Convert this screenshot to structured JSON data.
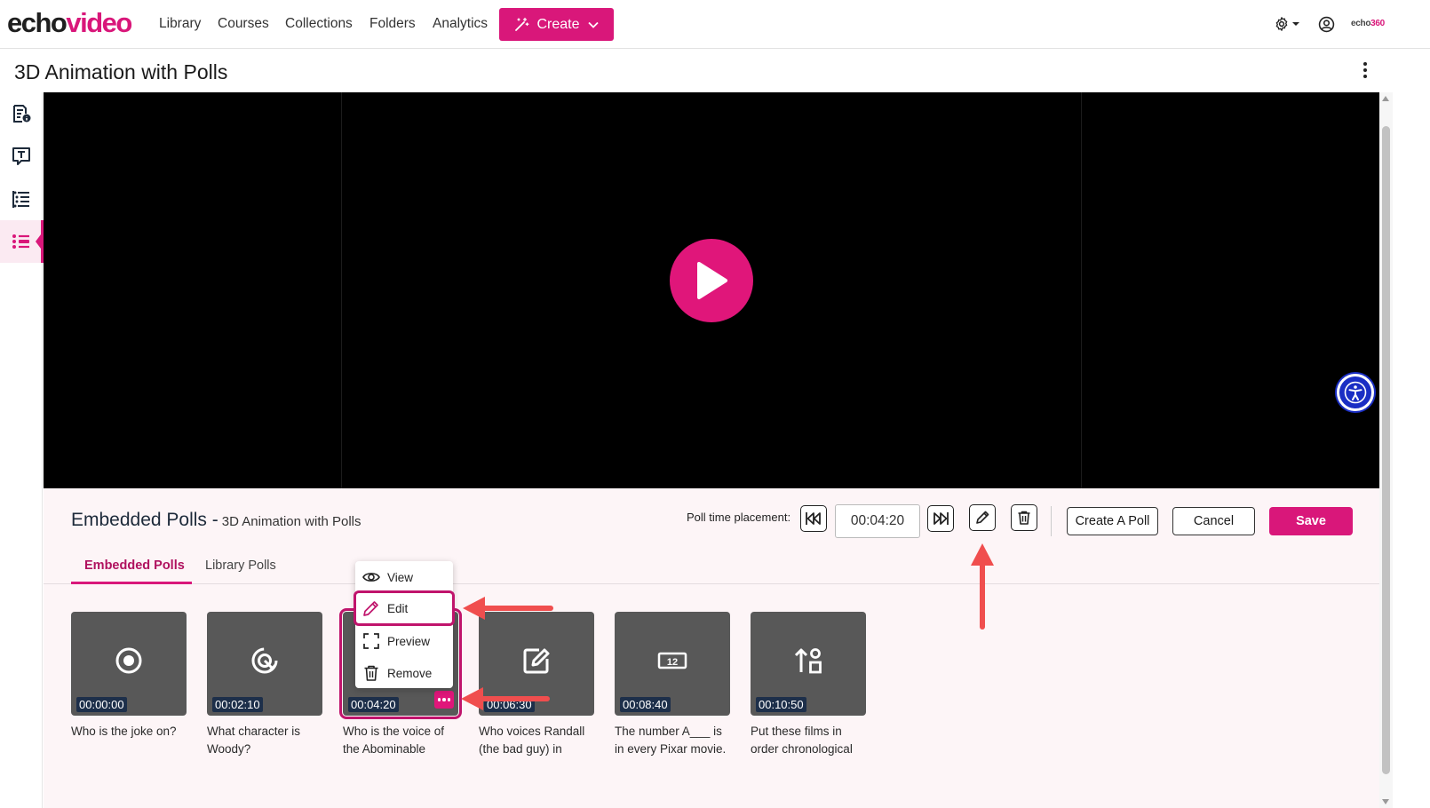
{
  "topnav": {
    "logo_echo": "echo",
    "logo_video": "video",
    "links": [
      "Library",
      "Courses",
      "Collections",
      "Folders",
      "Analytics"
    ],
    "create_label": "Create",
    "brand_small_a": "echo",
    "brand_small_b": "360"
  },
  "page": {
    "title": "3D Animation with Polls"
  },
  "sidebar": {
    "items": [
      "info-doc-icon",
      "transcript-icon",
      "chapters-icon",
      "polls-icon"
    ],
    "active_index": 3
  },
  "panel": {
    "title": "Embedded Polls -",
    "subtitle": "3D Animation with Polls",
    "placement_label": "Poll time placement:",
    "time_value": "00:04:20",
    "create_poll_label": "Create A Poll",
    "cancel_label": "Cancel",
    "save_label": "Save",
    "tabs": [
      "Embedded Polls",
      "Library Polls"
    ],
    "active_tab": 0
  },
  "polls": [
    {
      "time": "00:00:00",
      "caption_line1": "Who is the joke on?",
      "caption_line2": "",
      "icon": "radio-icon"
    },
    {
      "time": "00:02:10",
      "caption_line1": "What character is",
      "caption_line2": "Woody?",
      "icon": "hotspot-icon"
    },
    {
      "time": "00:04:20",
      "caption_line1": "Who is the voice of",
      "caption_line2": "the Abominable",
      "icon": "selected"
    },
    {
      "time": "00:06:30",
      "caption_line1": "Who voices Randall",
      "caption_line2": "(the bad guy) in",
      "icon": "edit-square-icon"
    },
    {
      "time": "00:08:40",
      "caption_line1": "The number A___ is",
      "caption_line2": "in every Pixar movie.",
      "icon": "numeric-icon"
    },
    {
      "time": "00:10:50",
      "caption_line1": "Put these films in",
      "caption_line2": "order chronological",
      "icon": "ordering-icon"
    }
  ],
  "menu": {
    "items": [
      "View",
      "Edit",
      "Preview",
      "Remove"
    ],
    "highlighted": "Edit"
  },
  "colors": {
    "accent": "#d9177a",
    "annotation_arrow": "#f04e4e",
    "card_bg": "#585858"
  }
}
